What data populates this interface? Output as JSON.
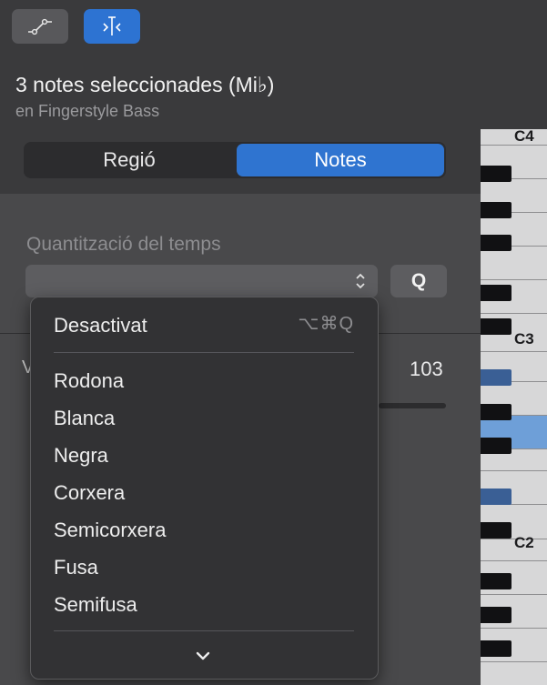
{
  "toolbar": {
    "automation_icon": "automation-curve-icon",
    "quantize_icon": "quantize-icon"
  },
  "header": {
    "title": "3 notes seleccionades (Mi♭)",
    "subtitle": "en Fingerstyle Bass"
  },
  "segmented": {
    "region_label": "Regió",
    "notes_label": "Notes",
    "selected": "Notes"
  },
  "quantize": {
    "label": "Quantització del temps",
    "value": "",
    "q_button": "Q"
  },
  "velocity": {
    "label": "V",
    "value": "103"
  },
  "menu": {
    "off_label": "Desactivat",
    "off_shortcut": "⌥⌘Q",
    "items": [
      "Rodona",
      "Blanca",
      "Negra",
      "Corxera",
      "Semicorxera",
      "Fusa",
      "Semifusa"
    ],
    "more_icon": "chevron-down-icon"
  },
  "piano": {
    "labels": [
      "C4",
      "C3",
      "C2"
    ]
  },
  "colors": {
    "accent": "#2d73d2",
    "selected_key": "#6e9fd8",
    "selected_black_key": "#3a5f95"
  }
}
